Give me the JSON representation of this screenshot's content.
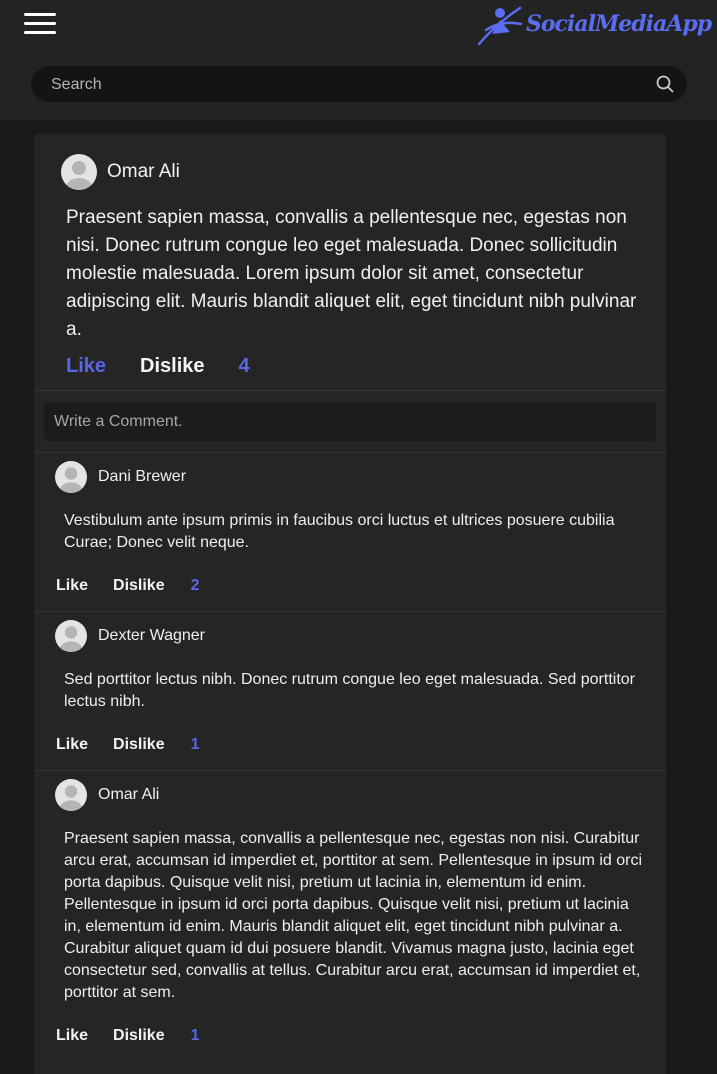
{
  "header": {
    "logo_text": "SocialMediaApp",
    "search_placeholder": "Search"
  },
  "post": {
    "author": "Omar Ali",
    "body": "Praesent sapien massa, convallis a pellentesque nec, egestas non nisi. Donec rutrum congue leo eget malesuada. Donec sollicitudin molestie malesuada. Lorem ipsum dolor sit amet, consectetur adipiscing elit. Mauris blandit aliquet elit, eget tincidunt nibh pulvinar a.",
    "like_label": "Like",
    "dislike_label": "Dislike",
    "like_count": "4",
    "comment_placeholder": "Write a Comment."
  },
  "comments": [
    {
      "author": "Dani Brewer",
      "body": "Vestibulum ante ipsum primis in faucibus orci luctus et ultrices posuere cubilia Curae; Donec velit neque.",
      "like_label": "Like",
      "dislike_label": "Dislike",
      "count": "2"
    },
    {
      "author": "Dexter Wagner",
      "body": "Sed porttitor lectus nibh. Donec rutrum congue leo eget malesuada. Sed porttitor lectus nibh.",
      "like_label": "Like",
      "dislike_label": "Dislike",
      "count": "1"
    },
    {
      "author": "Omar Ali",
      "body": "Praesent sapien massa, convallis a pellentesque nec, egestas non nisi. Curabitur arcu erat, accumsan id imperdiet et, porttitor at sem. Pellentesque in ipsum id orci porta dapibus. Quisque velit nisi, pretium ut lacinia in, elementum id enim. Pellentesque in ipsum id orci porta dapibus. Quisque velit nisi, pretium ut lacinia in, elementum id enim. Mauris blandit aliquet elit, eget tincidunt nibh pulvinar a. Curabitur aliquet quam id dui posuere blandit. Vivamus magna justo, lacinia eget consectetur sed, convallis at tellus. Curabitur arcu erat, accumsan id imperdiet et, porttitor at sem.",
      "like_label": "Like",
      "dislike_label": "Dislike",
      "count": "1"
    }
  ],
  "colors": {
    "background": "#1a1a1b",
    "header": "#232324",
    "card": "#252526",
    "accent": "#5866e8"
  },
  "icons": [
    "menu-icon",
    "logo-icon",
    "search-icon",
    "avatar-icon"
  ]
}
